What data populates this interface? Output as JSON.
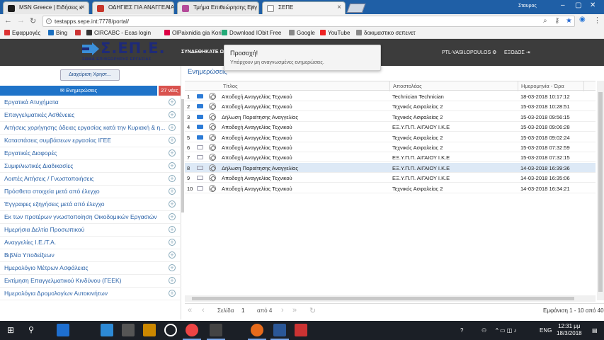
{
  "browser": {
    "tabs": [
      {
        "title": "MSN Greece | Ειδήσεις κ",
        "color": "#1e1e1e"
      },
      {
        "title": "ΟΔΗΓΙΕΣ ΓΙΑ ΑΝΑΓΓΕΛΙΑ",
        "color": "#c7362b"
      },
      {
        "title": "Τμήμα Επιθεώρησης Εργ",
        "color": "#b54b9a"
      },
      {
        "title": "ΣΕΠΕ",
        "color": "#ffffff"
      }
    ],
    "profile_name": "Σταυρος",
    "url": "testapps.sepe.int:7778/portal/",
    "bookmarks": [
      {
        "label": "Εφαρμογές",
        "color": "#d33"
      },
      {
        "label": "Bing",
        "color": "#1b6fbf"
      },
      {
        "label": "",
        "color": "#c33"
      },
      {
        "label": "CIRCABC - Ecas login",
        "color": "#333"
      },
      {
        "label": "OlPaixnidia gia Korits",
        "color": "#d04"
      },
      {
        "label": "Download IObit Free",
        "color": "#2a7"
      },
      {
        "label": "Google",
        "color": "#888"
      },
      {
        "label": "YouTube",
        "color": "#e22"
      },
      {
        "label": "δοκιμαστικο σεπενετ",
        "color": "#888"
      }
    ]
  },
  "header": {
    "logo_text": "Σ.ΕΠ.Ε.",
    "logo_sub": "ΣΩΜΑ ΕΠΙΘΕΩΡΗΣΗΣ ΕΡΓΑΣΙΑΣ",
    "connected_label": "ΣΥΝΔΕΘΗΚΑΤΕ ΩΣ",
    "user": "PTL-VASILOPOULOS",
    "logout": "ΕΞΟΔΟΣ"
  },
  "toast": {
    "title": "Προσοχή!",
    "message": "Υπάρχουν μη αναγνωσμένες ενημερώσεις."
  },
  "sidebar": {
    "management_button": "Διαχείριση Χρηστ...",
    "notifications_tab": "Ενημερώσεις",
    "notifications_badge": "27 νέες",
    "items": [
      "Εργατικά Ατυχήματα",
      "Επαγγελματικές Ασθένειες",
      "Αιτήσεις χορήγησης άδειας εργασίας κατά την Κυριακή & η...",
      "Καταστάσεις συμβάσεων εργασίας ΙΓΕΕ",
      "Εργατικές Διαφορές",
      "Συμφιλιωτικές Διαδικασίες",
      "Λοιπές Αιτήσεις / Γνωστοποιήσεις",
      "Πρόσθετα στοιχεία μετά από έλεγχο",
      "Έγγραφες εξηγήσεις μετά από έλεγχο",
      "Εκ των προτέρων γνωστοποίηση Οικοδομικών Εργασιών",
      "Ημερήσια Δελτία Προσωπικού",
      "Αναγγελίες Ι.Ε./Τ.Α.",
      "Βιβλία Υποδείξεων",
      "Ημερολόγιο Μέτρων Ασφάλειας",
      "Εκτίμηση Επαγγελματικού Κινδύνου (ΓΕΕΚ)",
      "Ημερολόγια Δρομολογίων Αυτοκινήτων"
    ]
  },
  "main": {
    "title": "Ενημερώσεις",
    "columns": {
      "title": "Τίτλος",
      "sender": "Αποστολέας",
      "date": "Ημερομηνία - Ώρα"
    },
    "rows": [
      {
        "n": "1",
        "unread": true,
        "title": "Αποδοχή Αναγγελίας Τεχνικού",
        "sender": "Technician Technician",
        "date": "18-03-2018 10:17:12"
      },
      {
        "n": "2",
        "unread": true,
        "title": "Αποδοχή Αναγγελίας Τεχνικού",
        "sender": "Τεχνικός Ασφαλείας 2",
        "date": "15-03-2018 10:28:51"
      },
      {
        "n": "3",
        "unread": true,
        "title": "Δήλωση Παραίτησης Αναγγελίας",
        "sender": "Τεχνικός Ασφαλείας 2",
        "date": "15-03-2018 09:56:15"
      },
      {
        "n": "4",
        "unread": true,
        "title": "Αποδοχή Αναγγελίας Τεχνικού",
        "sender": "ΕΞ.Υ.Π.Π. ΑΙΓΑΙΟΥ Ι.Κ.Ε",
        "date": "15-03-2018 09:06:28"
      },
      {
        "n": "5",
        "unread": true,
        "title": "Αποδοχή Αναγγελίας Τεχνικού",
        "sender": "Τεχνικός Ασφαλείας 2",
        "date": "15-03-2018 09:02:24"
      },
      {
        "n": "6",
        "unread": false,
        "title": "Αποδοχή Αναγγελίας Τεχνικού",
        "sender": "Τεχνικός Ασφαλείας 2",
        "date": "15-03-2018 07:32:59"
      },
      {
        "n": "7",
        "unread": false,
        "title": "Αποδοχή Αναγγελίας Τεχνικού",
        "sender": "ΕΞ.Υ.Π.Π. ΑΙΓΑΙΟΥ Ι.Κ.Ε",
        "date": "15-03-2018 07:32:15"
      },
      {
        "n": "8",
        "unread": false,
        "selected": true,
        "title": "Δήλωση Παραίτησης Αναγγελίας",
        "sender": "ΕΞ.Υ.Π.Π. ΑΙΓΑΙΟΥ Ι.Κ.Ε",
        "date": "14-03-2018 16:39:36"
      },
      {
        "n": "9",
        "unread": false,
        "title": "Αποδοχή Αναγγελίας Τεχνικού",
        "sender": "ΕΞ.Υ.Π.Π. ΑΙΓΑΙΟΥ Ι.Κ.Ε",
        "date": "14-03-2018 16:35:06"
      },
      {
        "n": "10",
        "unread": false,
        "title": "Αποδοχή Αναγγελίας Τεχνικού",
        "sender": "Τεχνικός Ασφαλείας 2",
        "date": "14-03-2018 16:34:21"
      }
    ],
    "pager": {
      "page_label": "Σελίδα",
      "page": "1",
      "of_label": "από 4",
      "summary": "Εμφάνιση 1 - 10 από 40"
    }
  },
  "taskbar": {
    "icons": [
      {
        "name": "edge-icon",
        "color": "#1e6fd0"
      },
      {
        "name": "store-icon",
        "color": "#2d8ad6"
      },
      {
        "name": "shop-icon",
        "color": "#555"
      },
      {
        "name": "app-icon",
        "color": "#c80"
      },
      {
        "name": "hp-icon",
        "color": "#fff"
      },
      {
        "name": "chrome-icon",
        "color": "#e44"
      },
      {
        "name": "media-icon",
        "color": "#444"
      },
      {
        "name": "firefox-icon",
        "color": "#e76b1c"
      },
      {
        "name": "word-icon",
        "color": "#2b5797"
      },
      {
        "name": "shield-app-icon",
        "color": "#c33"
      }
    ],
    "lang": "ENG",
    "time": "12:31 μμ",
    "date": "18/3/2018"
  }
}
